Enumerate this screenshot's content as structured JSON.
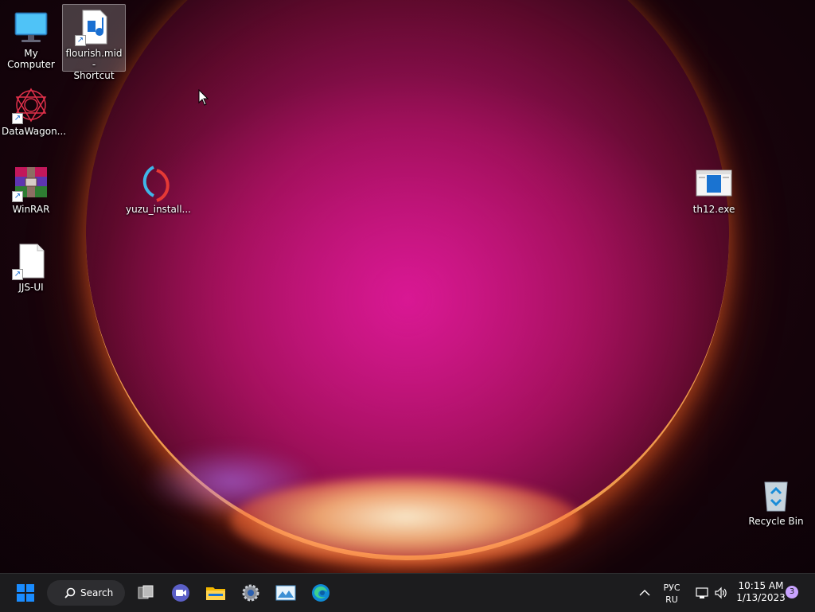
{
  "desktop": {
    "icons": [
      {
        "label": "My Computer"
      },
      {
        "label": "flourish.mid -\nShortcut"
      },
      {
        "label": "DataWagon..."
      },
      {
        "label": "WinRAR"
      },
      {
        "label": "yuzu_install..."
      },
      {
        "label": "JJS-UI"
      },
      {
        "label": "th12.exe"
      },
      {
        "label": "Recycle Bin"
      }
    ]
  },
  "taskbar": {
    "search_label": "Search",
    "apps": [
      "start-icon",
      "search-icon",
      "task-view-icon",
      "meet-icon",
      "file-explorer-icon",
      "settings-icon",
      "photos-icon",
      "edge-icon"
    ],
    "language_top": "РУС",
    "language_bottom": "RU",
    "time": "10:15 AM",
    "date": "1/13/2023",
    "notification_count": "3"
  },
  "colors": {
    "taskbar_bg": "#1c1c1e",
    "accent_blue": "#1a8cff",
    "wallpaper_magenta": "#c8128a",
    "wallpaper_glow": "#ffd9a0"
  }
}
